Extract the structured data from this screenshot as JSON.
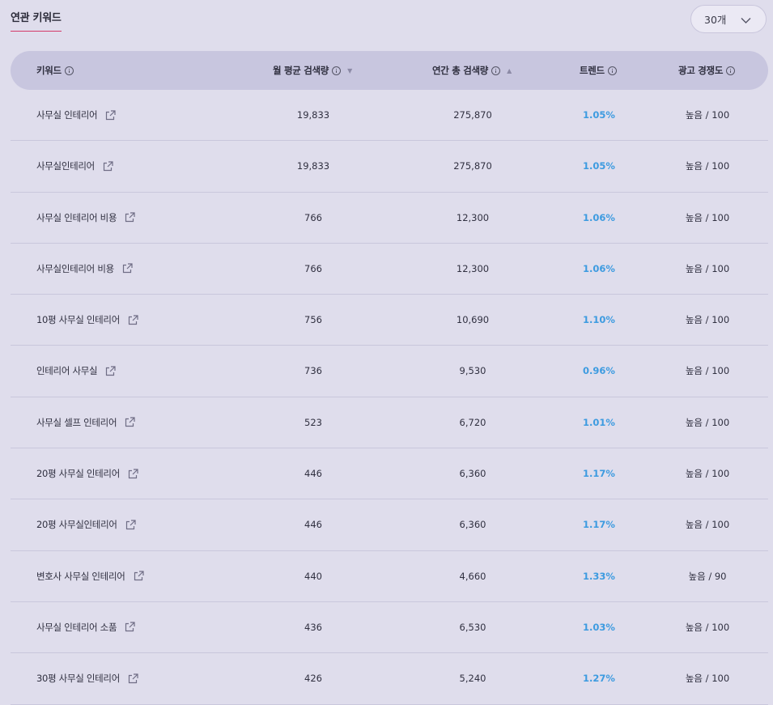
{
  "section_title": "연관 키워드",
  "count_select": {
    "value": "30개"
  },
  "columns": [
    {
      "key": "keyword",
      "label": "키워드",
      "sort": null
    },
    {
      "key": "monthly",
      "label": "월 평균 검색량",
      "sort": "desc"
    },
    {
      "key": "yearly",
      "label": "연간 총 검색량",
      "sort": "asc"
    },
    {
      "key": "trend",
      "label": "트렌드",
      "sort": null
    },
    {
      "key": "competition",
      "label": "광고 경쟁도",
      "sort": null
    }
  ],
  "colors": {
    "accent_underline": "#d43a6a",
    "trend": "#3d9be0",
    "header_bg": "#c8c6df",
    "page_bg": "#dfddec"
  },
  "rows": [
    {
      "keyword": "사무실 인테리어",
      "monthly": "19,833",
      "yearly": "275,870",
      "trend": "1.05%",
      "competition": "높음 / 100"
    },
    {
      "keyword": "사무실인테리어",
      "monthly": "19,833",
      "yearly": "275,870",
      "trend": "1.05%",
      "competition": "높음 / 100"
    },
    {
      "keyword": "사무실 인테리어 비용",
      "monthly": "766",
      "yearly": "12,300",
      "trend": "1.06%",
      "competition": "높음 / 100"
    },
    {
      "keyword": "사무실인테리어 비용",
      "monthly": "766",
      "yearly": "12,300",
      "trend": "1.06%",
      "competition": "높음 / 100"
    },
    {
      "keyword": "10평 사무실 인테리어",
      "monthly": "756",
      "yearly": "10,690",
      "trend": "1.10%",
      "competition": "높음 / 100"
    },
    {
      "keyword": "인테리어 사무실",
      "monthly": "736",
      "yearly": "9,530",
      "trend": "0.96%",
      "competition": "높음 / 100"
    },
    {
      "keyword": "사무실 셀프 인테리어",
      "monthly": "523",
      "yearly": "6,720",
      "trend": "1.01%",
      "competition": "높음 / 100"
    },
    {
      "keyword": "20평 사무실 인테리어",
      "monthly": "446",
      "yearly": "6,360",
      "trend": "1.17%",
      "competition": "높음 / 100"
    },
    {
      "keyword": "20평 사무실인테리어",
      "monthly": "446",
      "yearly": "6,360",
      "trend": "1.17%",
      "competition": "높음 / 100"
    },
    {
      "keyword": "변호사 사무실 인테리어",
      "monthly": "440",
      "yearly": "4,660",
      "trend": "1.33%",
      "competition": "높음 / 90"
    },
    {
      "keyword": "사무실 인테리어 소품",
      "monthly": "436",
      "yearly": "6,530",
      "trend": "1.03%",
      "competition": "높음 / 100"
    },
    {
      "keyword": "30평 사무실 인테리어",
      "monthly": "426",
      "yearly": "5,240",
      "trend": "1.27%",
      "competition": "높음 / 100"
    }
  ]
}
